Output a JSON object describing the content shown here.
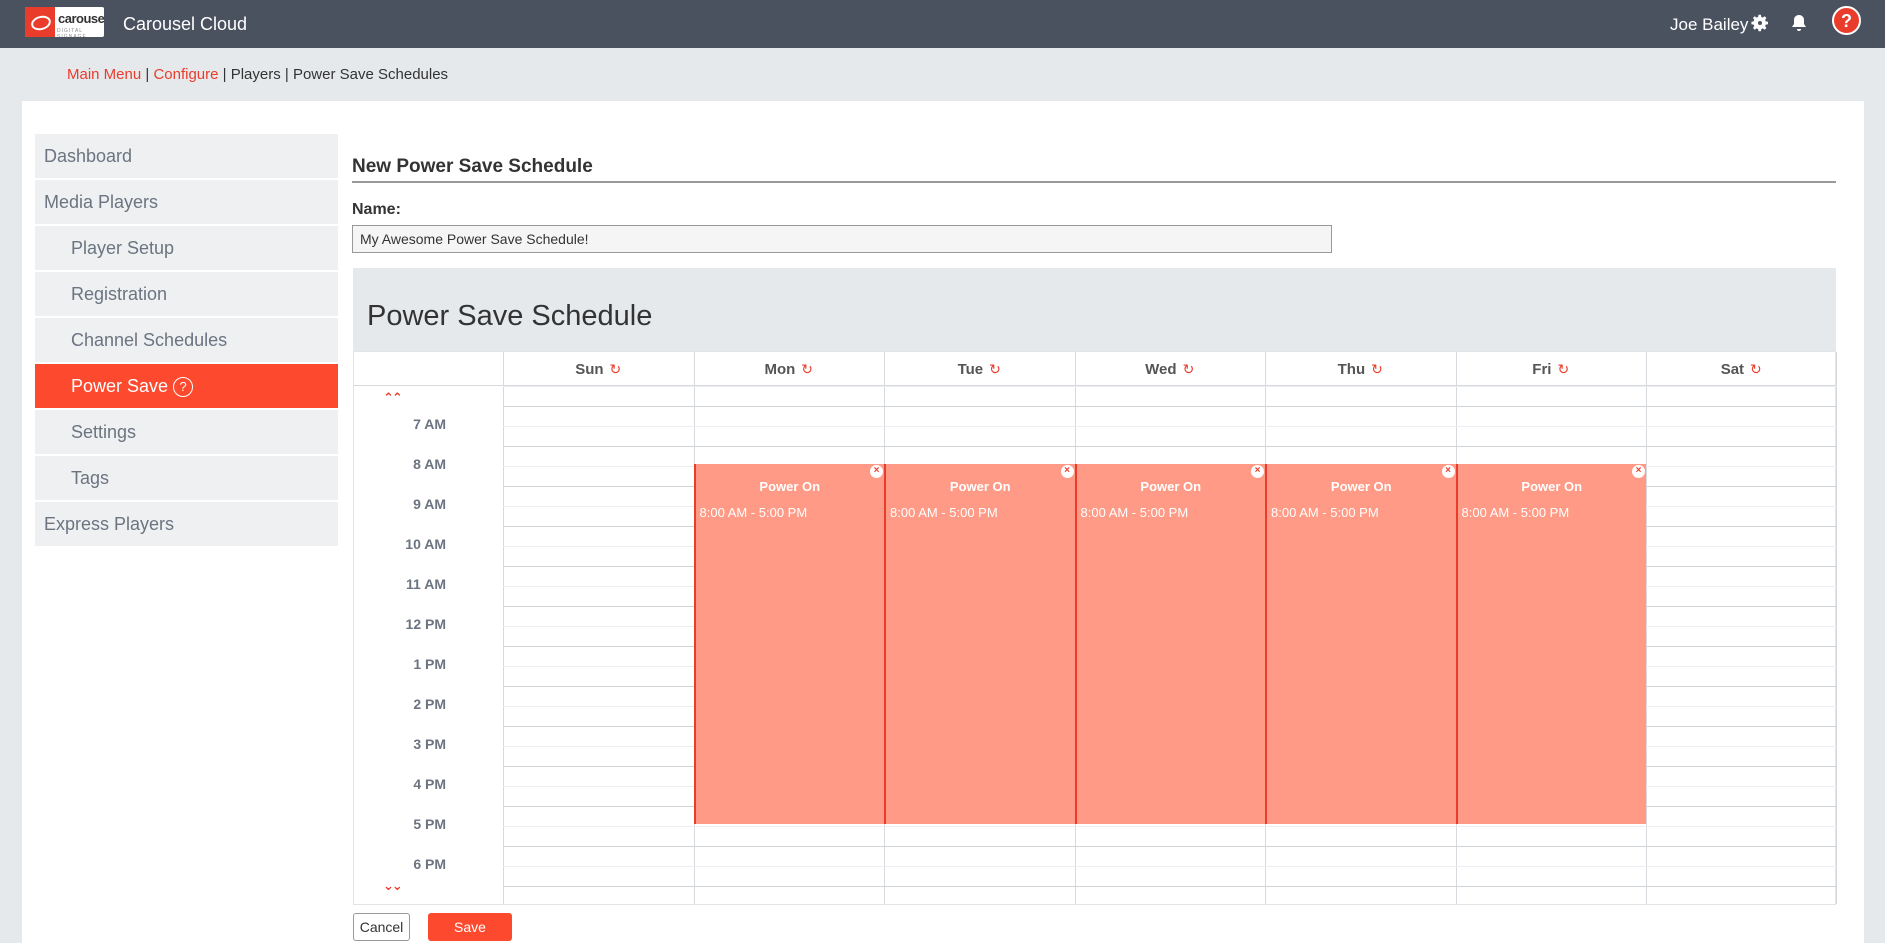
{
  "app": {
    "title": "Carousel Cloud",
    "logo_word": "carousel",
    "logo_sub": "DIGITAL SIGNAGE",
    "user_name": "Joe Bailey",
    "help_label": "?"
  },
  "breadcrumb": {
    "main_menu": "Main Menu",
    "sep1": " | ",
    "configure": "Configure",
    "rest": " | Players | Power Save Schedules"
  },
  "sidebar": {
    "items": [
      {
        "label": "Dashboard"
      },
      {
        "label": "Media Players"
      },
      {
        "label": "Player Setup"
      },
      {
        "label": "Registration"
      },
      {
        "label": "Channel Schedules"
      },
      {
        "label": "Power Save",
        "help": "?"
      },
      {
        "label": "Settings"
      },
      {
        "label": "Tags"
      },
      {
        "label": "Express Players"
      }
    ]
  },
  "form": {
    "title": "New Power Save Schedule",
    "name_label": "Name:",
    "name_value": "My Awesome Power Save Schedule!"
  },
  "schedule": {
    "title": "Power Save Schedule",
    "days": [
      "Sun",
      "Mon",
      "Tue",
      "Wed",
      "Thu",
      "Fri",
      "Sat"
    ],
    "times": [
      "7 AM",
      "8 AM",
      "9 AM",
      "10 AM",
      "11 AM",
      "12 PM",
      "1 PM",
      "2 PM",
      "3 PM",
      "4 PM",
      "5 PM",
      "6 PM"
    ],
    "scroll_up": "⌃⌃",
    "scroll_down": "⌄⌄",
    "events": [
      {
        "day": "Mon",
        "title": "Power On",
        "time": "8:00 AM - 5:00 PM"
      },
      {
        "day": "Tue",
        "title": "Power On",
        "time": "8:00 AM - 5:00 PM"
      },
      {
        "day": "Wed",
        "title": "Power On",
        "time": "8:00 AM - 5:00 PM"
      },
      {
        "day": "Thu",
        "title": "Power On",
        "time": "8:00 AM - 5:00 PM"
      },
      {
        "day": "Fri",
        "title": "Power On",
        "time": "8:00 AM - 5:00 PM"
      }
    ]
  },
  "buttons": {
    "cancel": "Cancel",
    "save": "Save"
  },
  "colors": {
    "accent": "#fd4a2f",
    "event_fill": "#fe9a85",
    "topbar": "#4a5260"
  }
}
